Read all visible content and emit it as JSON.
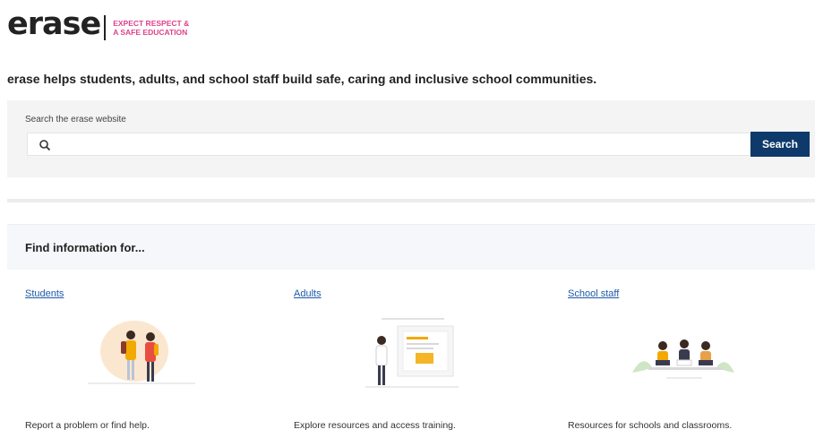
{
  "brand": {
    "logo_text": "erase",
    "tagline_line1": "EXPECT RESPECT &",
    "tagline_line2": "A SAFE EDUCATION",
    "accent_color": "#e0418a"
  },
  "intro": "erase helps students, adults, and school staff build safe, caring and inclusive school communities.",
  "search": {
    "label": "Search the erase website",
    "placeholder": "",
    "value": "",
    "button_label": "Search",
    "button_color": "#0e3a6b"
  },
  "info": {
    "title": "Find information for...",
    "columns": [
      {
        "link": "Students",
        "description": "Report a problem or find help.",
        "icon": "students-illustration"
      },
      {
        "link": "Adults",
        "description": "Explore resources and access training.",
        "icon": "adults-illustration"
      },
      {
        "link": "School staff",
        "description": "Resources for schools and classrooms.",
        "icon": "school-staff-illustration"
      }
    ],
    "link_color": "#1e5aa8"
  }
}
